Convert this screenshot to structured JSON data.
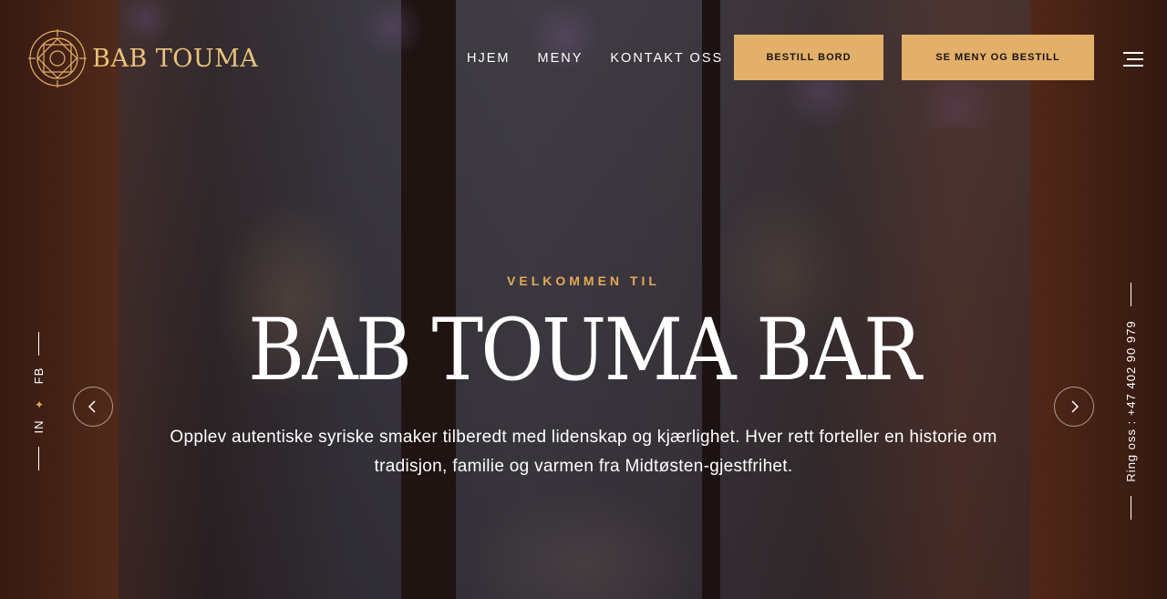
{
  "brand": {
    "name": "BAB TOUMA",
    "accent_color": "#e3b06a"
  },
  "nav": {
    "items": [
      "HJEM",
      "MENY",
      "KONTAKT OSS"
    ]
  },
  "buttons": {
    "book": "BESTILL BORD",
    "menu_order": "SE MENY OG BESTILL"
  },
  "hero": {
    "eyebrow": "VELKOMMEN TIL",
    "title": "BAB TOUMA BAR",
    "description": "Opplev autentiske syriske smaker tilberedt med lidenskap og kjærlighet. Hver rett forteller en historie om tradisjon, familie og varmen fra Midtøsten-gjestfrihet."
  },
  "social": {
    "facebook": "FB",
    "instagram": "IN"
  },
  "contact": {
    "phone_label": "Ring oss : +47 402 90 979"
  },
  "icons": {
    "logo": "ornament-logo-icon",
    "menu": "hamburger-icon",
    "prev": "chevron-left-icon",
    "next": "chevron-right-icon",
    "separator": "star-icon"
  }
}
